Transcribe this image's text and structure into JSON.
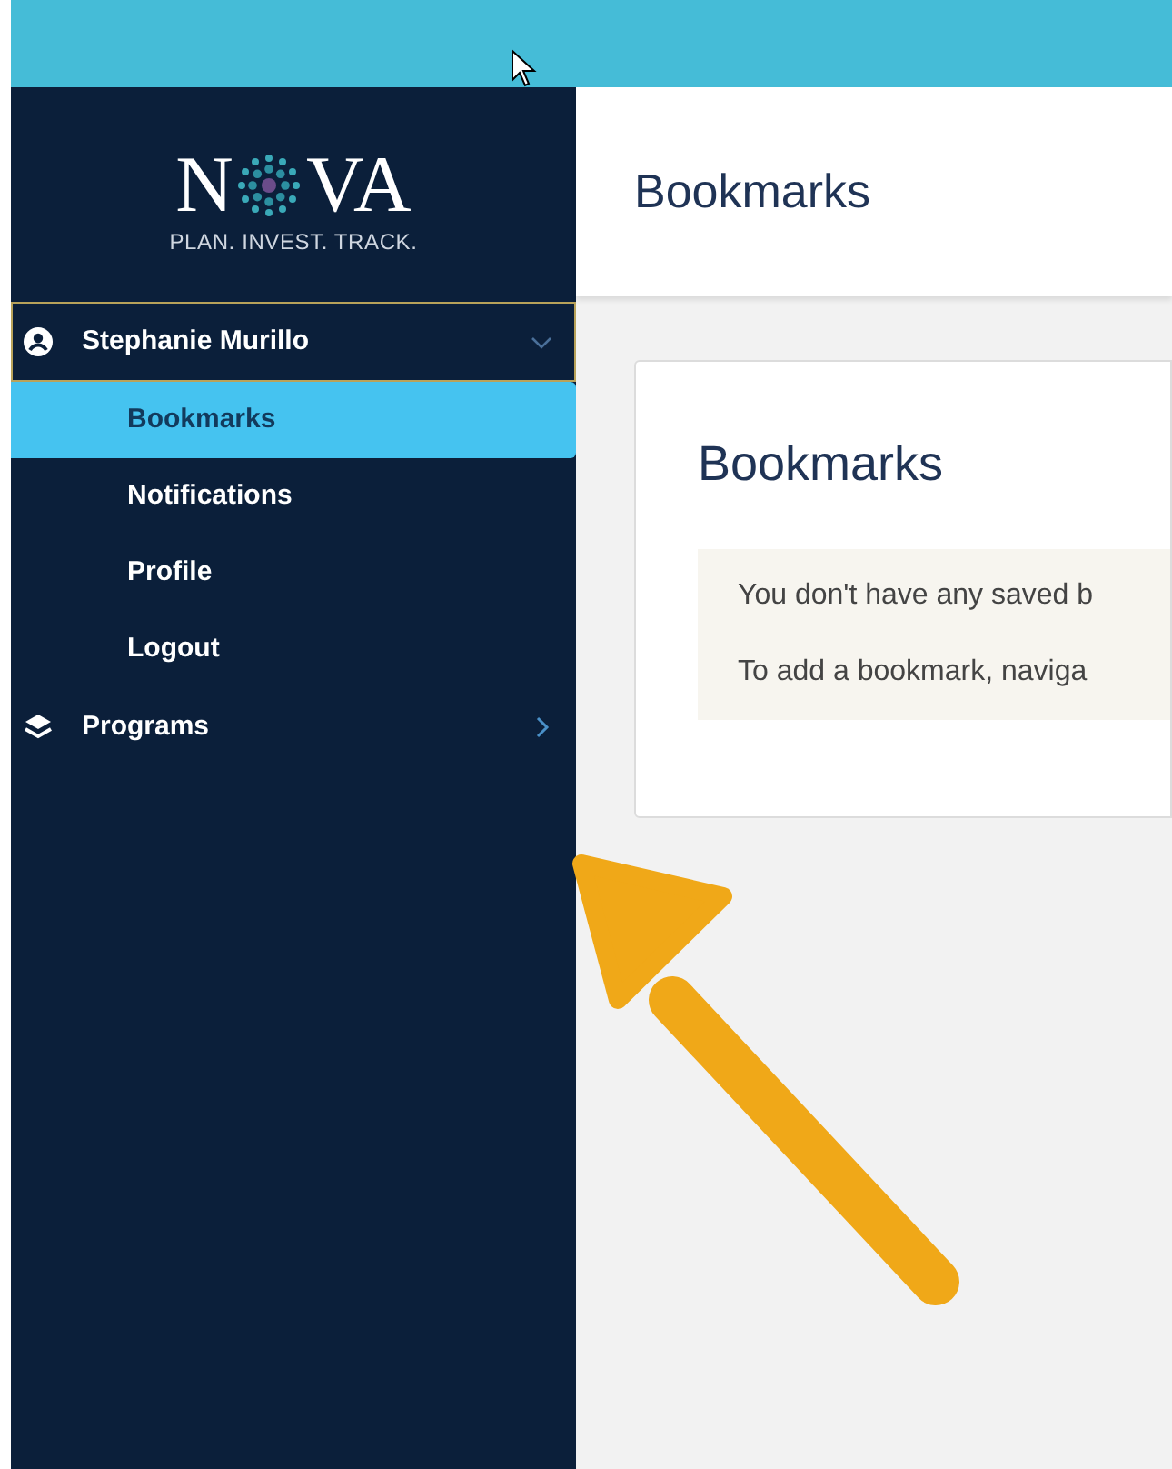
{
  "logo": {
    "text_before_mark": "N",
    "text_after_mark": "VA",
    "tagline": "PLAN. INVEST. TRACK."
  },
  "sidebar": {
    "items": [
      {
        "label": "Stephanie Murillo",
        "kind": "user",
        "expanded": true,
        "focused": true,
        "children": [
          {
            "label": "Bookmarks",
            "selected": true
          },
          {
            "label": "Notifications",
            "selected": false
          },
          {
            "label": "Profile",
            "selected": false
          },
          {
            "label": "Logout",
            "selected": false
          }
        ]
      },
      {
        "label": "Programs",
        "kind": "layers",
        "expanded": false,
        "focused": false
      }
    ]
  },
  "header": {
    "title": "Bookmarks"
  },
  "card": {
    "title": "Bookmarks",
    "notice": [
      "You don't have any saved b",
      "To add a bookmark, naviga"
    ]
  }
}
